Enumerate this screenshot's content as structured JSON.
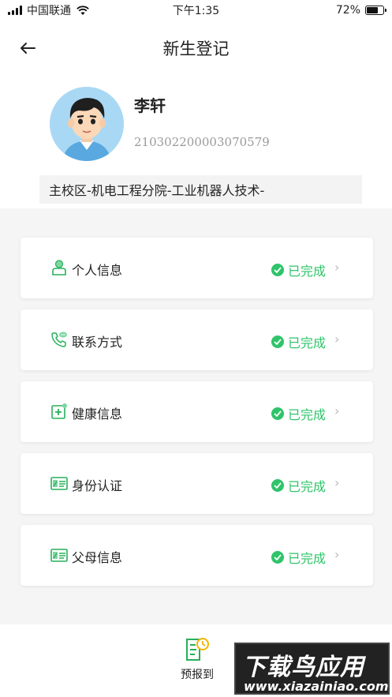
{
  "status_bar": {
    "carrier": "中国联通",
    "time": "下午1:35",
    "battery_percent": "72%",
    "battery_level": 0.72
  },
  "header": {
    "title": "新生登记",
    "back_icon": "arrow-left-icon"
  },
  "student": {
    "name": "李轩",
    "id_number": "210302200003070579",
    "department": "主校区-机电工程分院-工业机器人技术-"
  },
  "sections": [
    {
      "label": "个人信息",
      "icon": "person-icon",
      "status": "已完成"
    },
    {
      "label": "联系方式",
      "icon": "phone-icon",
      "status": "已完成"
    },
    {
      "label": "健康信息",
      "icon": "health-cross-icon",
      "status": "已完成"
    },
    {
      "label": "身份认证",
      "icon": "id-card-icon",
      "status": "已完成"
    },
    {
      "label": "父母信息",
      "icon": "id-card-icon",
      "status": "已完成"
    }
  ],
  "bottom_tab": {
    "label": "预报到",
    "icon": "pre-register-clock-icon"
  },
  "watermark": {
    "title": "下载鸟应用",
    "url": "www.xiazainiao.com"
  },
  "colors": {
    "accent_green": "#2fc46a",
    "icon_green": "#27b05a"
  }
}
